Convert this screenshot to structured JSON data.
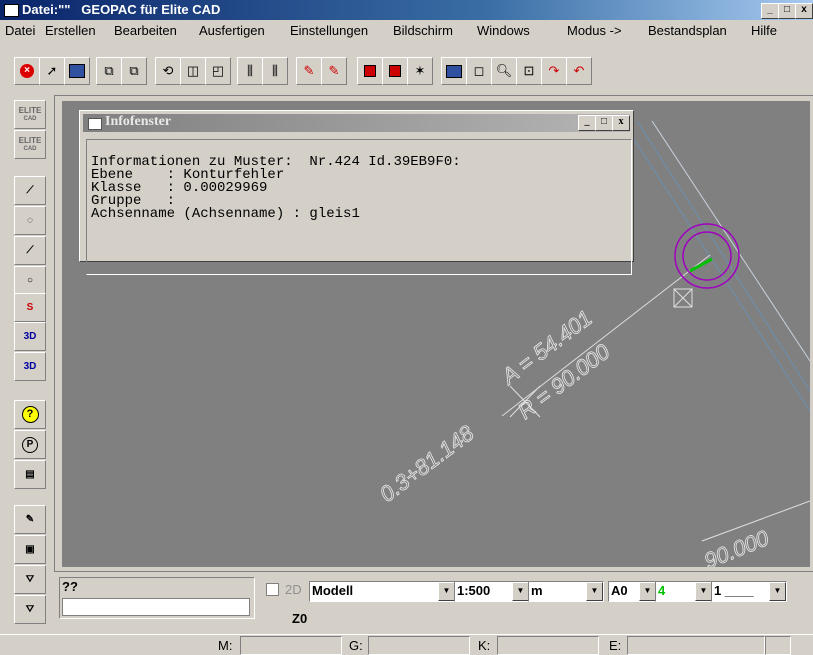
{
  "window": {
    "title": "Datei:\"\"   GEOPAC für Elite CAD"
  },
  "window_controls": {
    "minimize": "_",
    "maximize": "□",
    "close": "x"
  },
  "menu": [
    "Datei",
    "Erstellen",
    "Bearbeiten",
    "Ausfertigen",
    "Einstellungen",
    "Bildschirm",
    "Windows",
    "Modus ->",
    "Bestandsplan",
    "Hilfe"
  ],
  "left_toolbar": {
    "elite1": "ELITE",
    "elite1_sub": "CAD",
    "elite2": "ELITE",
    "elite2_sub": "CAD",
    "b3d_1": "3D",
    "b3d_2": "3D"
  },
  "info_window": {
    "title": "Infofenster",
    "lines": [
      "Informationen zu Muster:  Nr.424 Id.39EB9F0:",
      "Ebene    : Konturfehler",
      "Klasse   : 0.00029969",
      "Gruppe   :",
      "Achsenname (Achsenname) : gleis1"
    ]
  },
  "canvas": {
    "label_a": "A = 54.401",
    "label_r": "R = 90.000",
    "label_station": "0.3+81.148",
    "label_corner": "90.000"
  },
  "command": {
    "prompt": "??",
    "input_value": ""
  },
  "options": {
    "mode_2d": "2D",
    "model": "Modell",
    "scale": "1:500",
    "unit": "m",
    "paper": "A0",
    "color": "4",
    "linetype": "1 ____",
    "z_label": "Z0"
  },
  "status": {
    "m": "M:",
    "g": "G:",
    "k": "K:",
    "e": "E:"
  },
  "colors": {
    "title_active": "#0a246a",
    "canvas": "#808080",
    "circle": "#a000c0",
    "accent_green": "#00c000"
  }
}
